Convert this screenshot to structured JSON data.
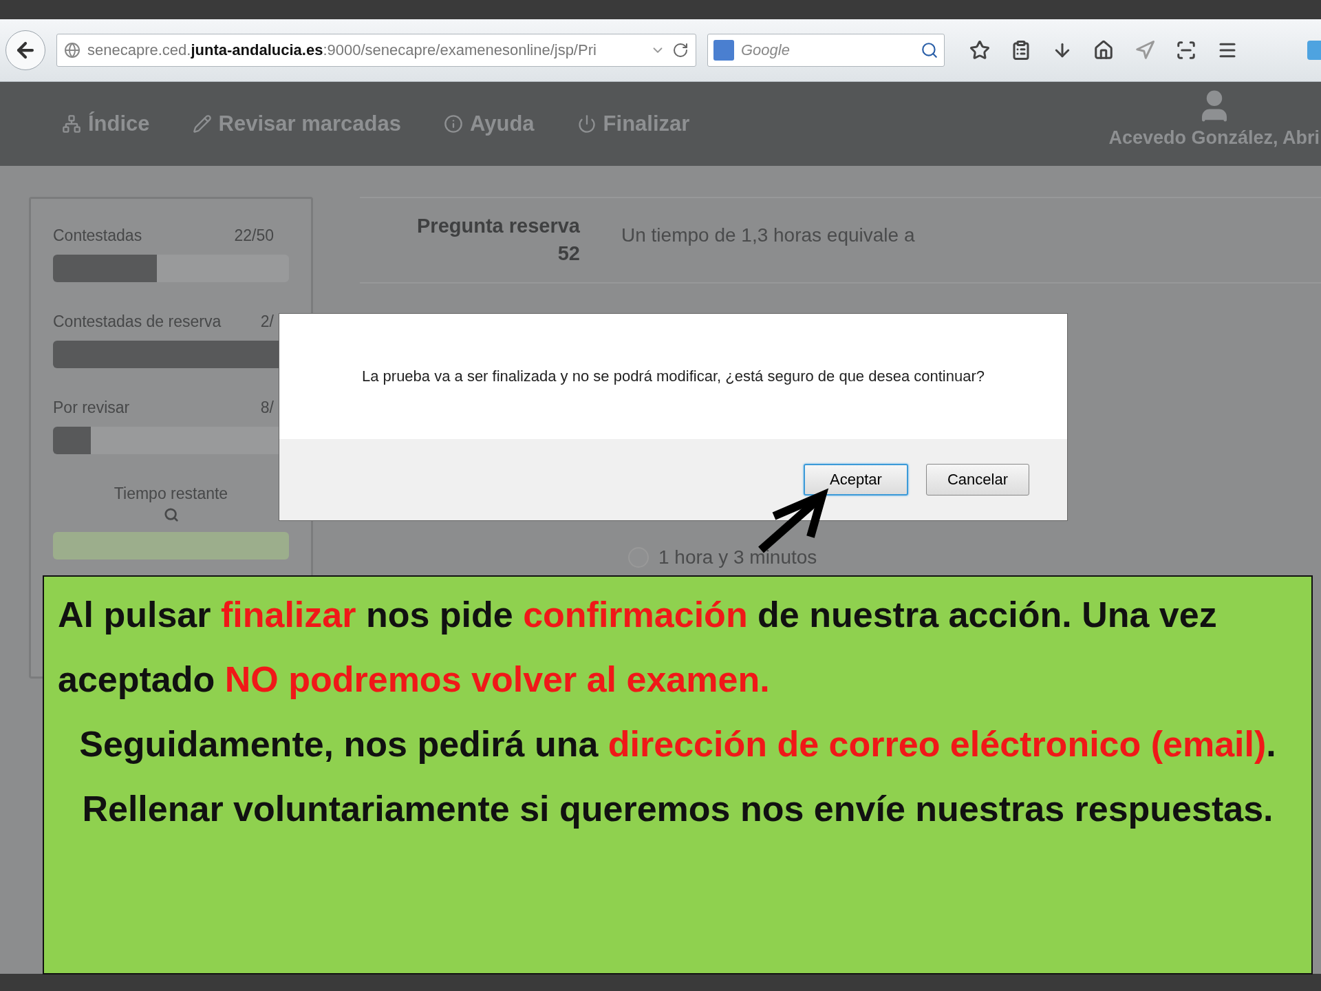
{
  "browser": {
    "url": "senecapre.ced.**junta-andalucia.es**:9000/senecapre/examenesonline/jsp/Pri",
    "search_placeholder": "Google"
  },
  "app_nav": {
    "items": [
      {
        "kind": "sitemap",
        "label": "Índice"
      },
      {
        "kind": "pencil",
        "label": "Revisar marcadas"
      },
      {
        "kind": "info",
        "label": "Ayuda"
      },
      {
        "kind": "power",
        "label": "Finalizar"
      }
    ],
    "user_name": "Acevedo González, Abri"
  },
  "sidebar": {
    "stats": [
      {
        "label": "Contestadas",
        "value": "22/50",
        "level": 0.44
      },
      {
        "label": "Contestadas de reserva",
        "value": "2/",
        "level": 1
      },
      {
        "label": "Por revisar",
        "value": "8/",
        "level": 0.16
      }
    ],
    "timer_label": "Tiempo restante"
  },
  "question": {
    "title": "Pregunta reserva",
    "number": "52",
    "text": "Un tiempo de 1,3 horas equivale a",
    "options": [
      {
        "label": "1 hora y 3 minutos",
        "selected": false
      }
    ]
  },
  "dialog": {
    "message": "La prueba va a ser finalizada y no se podrá modificar, ¿está seguro de que desea continuar?",
    "buttons": [
      {
        "label": "Aceptar",
        "focused": true
      },
      {
        "label": "Cancelar",
        "focused": false
      }
    ]
  },
  "note": {
    "paragraphs": [
      {
        "segments": [
          {
            "text": "Al pulsar ",
            "highlight": false
          },
          {
            "text": "finalizar",
            "highlight": true
          },
          {
            "text": " nos pide ",
            "highlight": false
          },
          {
            "text": "confirmación",
            "highlight": true
          },
          {
            "text": " de nuestra acción. Una vez aceptado ",
            "highlight": false
          },
          {
            "text": "NO podremos volver al examen.",
            "highlight": true
          }
        ]
      },
      {
        "segments": [
          {
            "text": "Seguidamente, nos pedirá una ",
            "highlight": false
          },
          {
            "text": "dirección de correo eléctronico (email)",
            "highlight": true
          },
          {
            "text": ". Rellenar voluntariamente si queremos nos envíe nuestras respuestas.",
            "highlight": false
          }
        ]
      }
    ]
  }
}
